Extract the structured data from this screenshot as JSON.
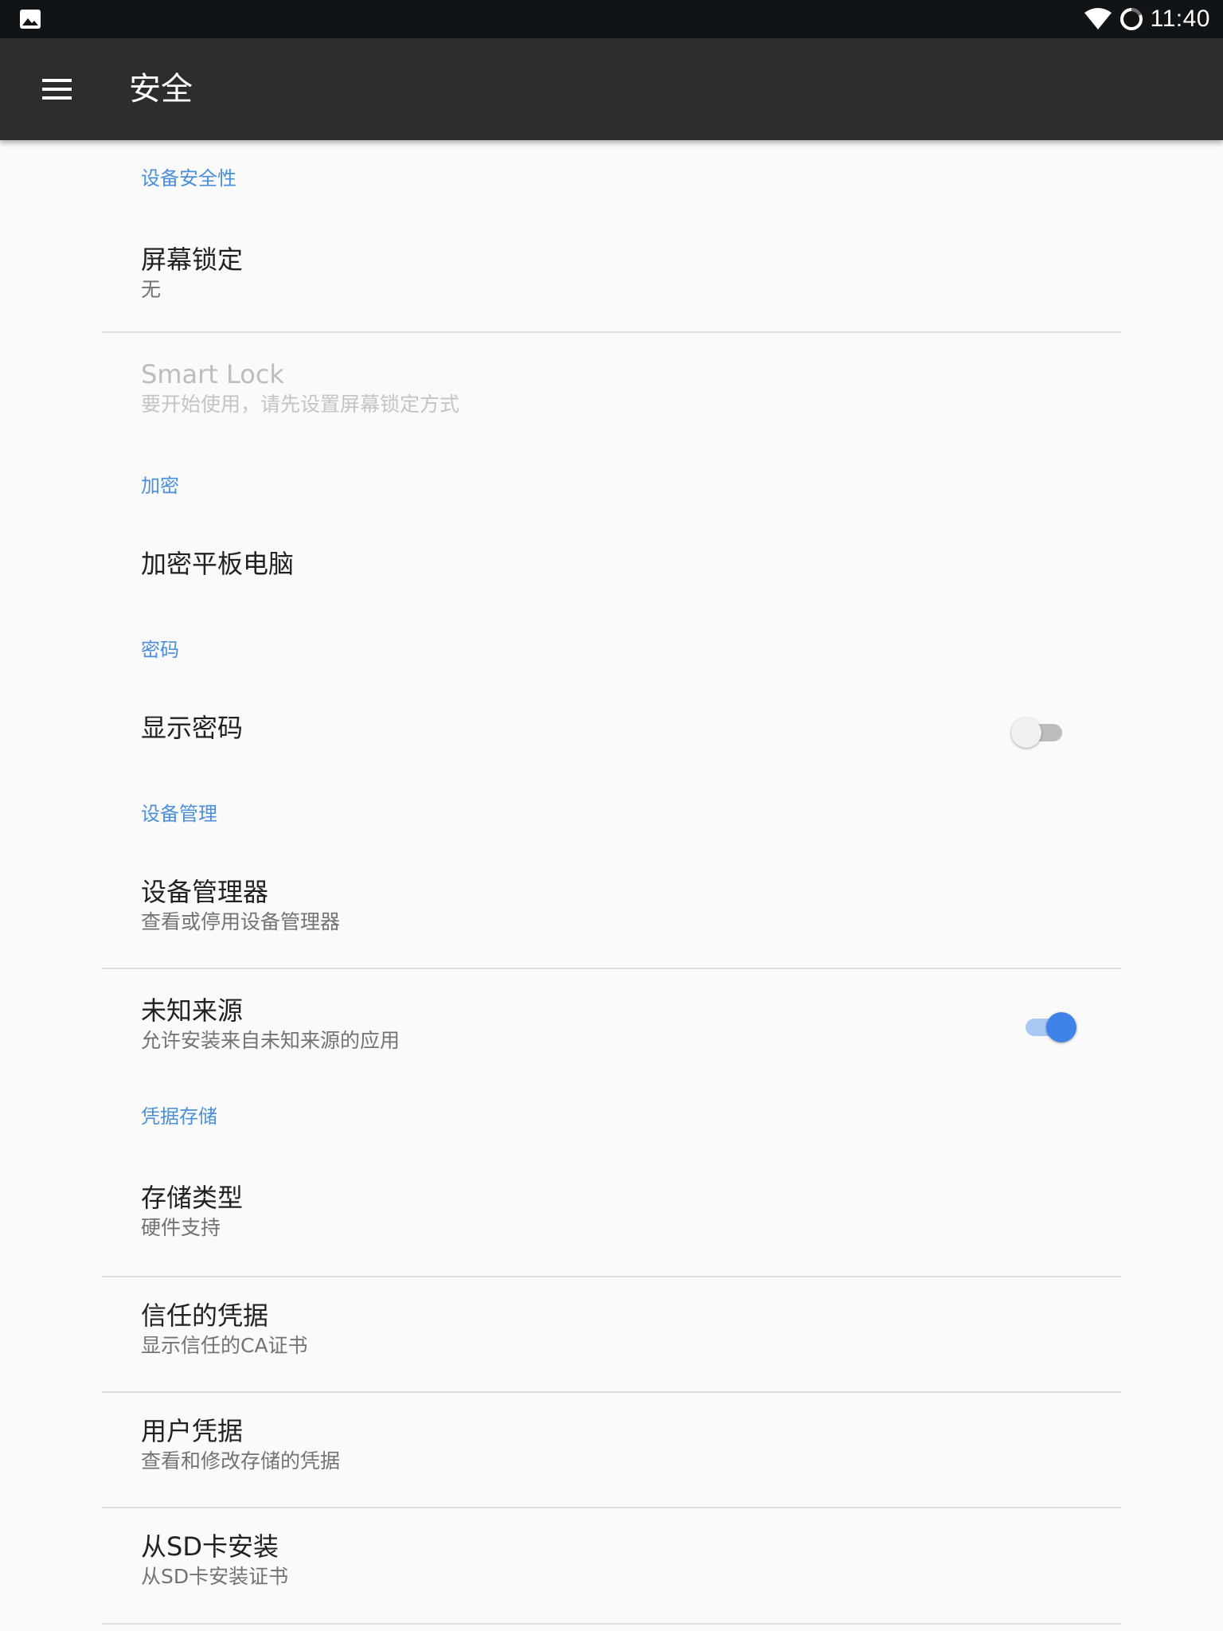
{
  "status_bar": {
    "time": "11:40",
    "left_icon": "image-notification-icon",
    "wifi_icon": "wifi-icon",
    "sync_icon": "loading-ring-icon"
  },
  "app_bar": {
    "menu_icon": "hamburger-menu-icon",
    "title": "安全"
  },
  "sections": {
    "device_security": {
      "header": "设备安全性",
      "screen_lock": {
        "title": "屏幕锁定",
        "summary": "无"
      },
      "smart_lock": {
        "title": "Smart Lock",
        "summary": "要开始使用，请先设置屏幕锁定方式",
        "enabled": false
      }
    },
    "encryption": {
      "header": "加密",
      "encrypt_tablet": {
        "title": "加密平板电脑"
      }
    },
    "passwords": {
      "header": "密码",
      "show_password": {
        "title": "显示密码",
        "checked": false
      }
    },
    "device_admin": {
      "header": "设备管理",
      "device_administrators": {
        "title": "设备管理器",
        "summary": "查看或停用设备管理器"
      },
      "unknown_sources": {
        "title": "未知来源",
        "summary": "允许安装来自未知来源的应用",
        "checked": true
      }
    },
    "credential_storage": {
      "header": "凭据存储",
      "storage_type": {
        "title": "存储类型",
        "summary": "硬件支持"
      },
      "trusted_credentials": {
        "title": "信任的凭据",
        "summary": "显示信任的CA证书"
      },
      "user_credentials": {
        "title": "用户凭据",
        "summary": "查看和修改存储的凭据"
      },
      "install_from_sd": {
        "title": "从SD卡安装",
        "summary": "从SD卡安装证书"
      }
    }
  },
  "colors": {
    "status_bar": "#111417",
    "app_bar": "#2d2d2d",
    "accent": "#4a8fd9",
    "switch_on": "#3f82e8",
    "background": "#fafafa"
  }
}
